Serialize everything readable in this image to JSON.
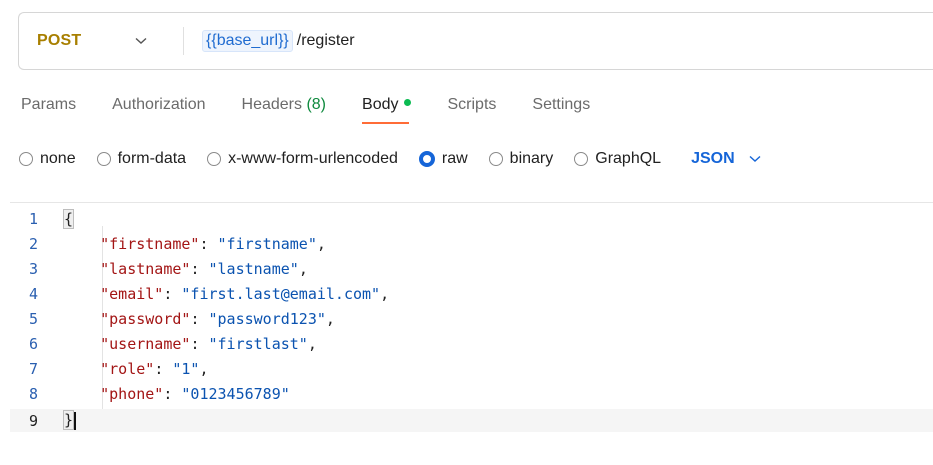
{
  "request": {
    "method": "POST",
    "url_variable": "{{base_url}}",
    "url_path": "/register"
  },
  "tabs": [
    {
      "label": "Params"
    },
    {
      "label": "Authorization"
    },
    {
      "label": "Headers",
      "count": "(8)"
    },
    {
      "label": "Body",
      "active": true
    },
    {
      "label": "Scripts"
    },
    {
      "label": "Settings"
    }
  ],
  "body_types": {
    "options": [
      "none",
      "form-data",
      "x-www-form-urlencoded",
      "raw",
      "binary",
      "GraphQL"
    ],
    "selected": "raw",
    "format": "JSON"
  },
  "colors": {
    "method": "#a87f00",
    "active_tab_underline": "#ff6c37",
    "body_indicator": "#0cbb52",
    "radio_selected": "#1565d8",
    "json_key": "#a31515",
    "json_string": "#0b53b0"
  },
  "editor": {
    "line_numbers": [
      "1",
      "2",
      "3",
      "4",
      "5",
      "6",
      "7",
      "8",
      "9"
    ],
    "open_brace": "{",
    "close_brace": "}",
    "fields": [
      {
        "key": "\"firstname\"",
        "value": "\"firstname\""
      },
      {
        "key": "\"lastname\"",
        "value": "\"lastname\""
      },
      {
        "key": "\"email\"",
        "value": "\"first.last@email.com\""
      },
      {
        "key": "\"password\"",
        "value": "\"password123\""
      },
      {
        "key": "\"username\"",
        "value": "\"firstlast\""
      },
      {
        "key": "\"role\"",
        "value": "\"1\""
      },
      {
        "key": "\"phone\"",
        "value": "\"0123456789\""
      }
    ]
  }
}
